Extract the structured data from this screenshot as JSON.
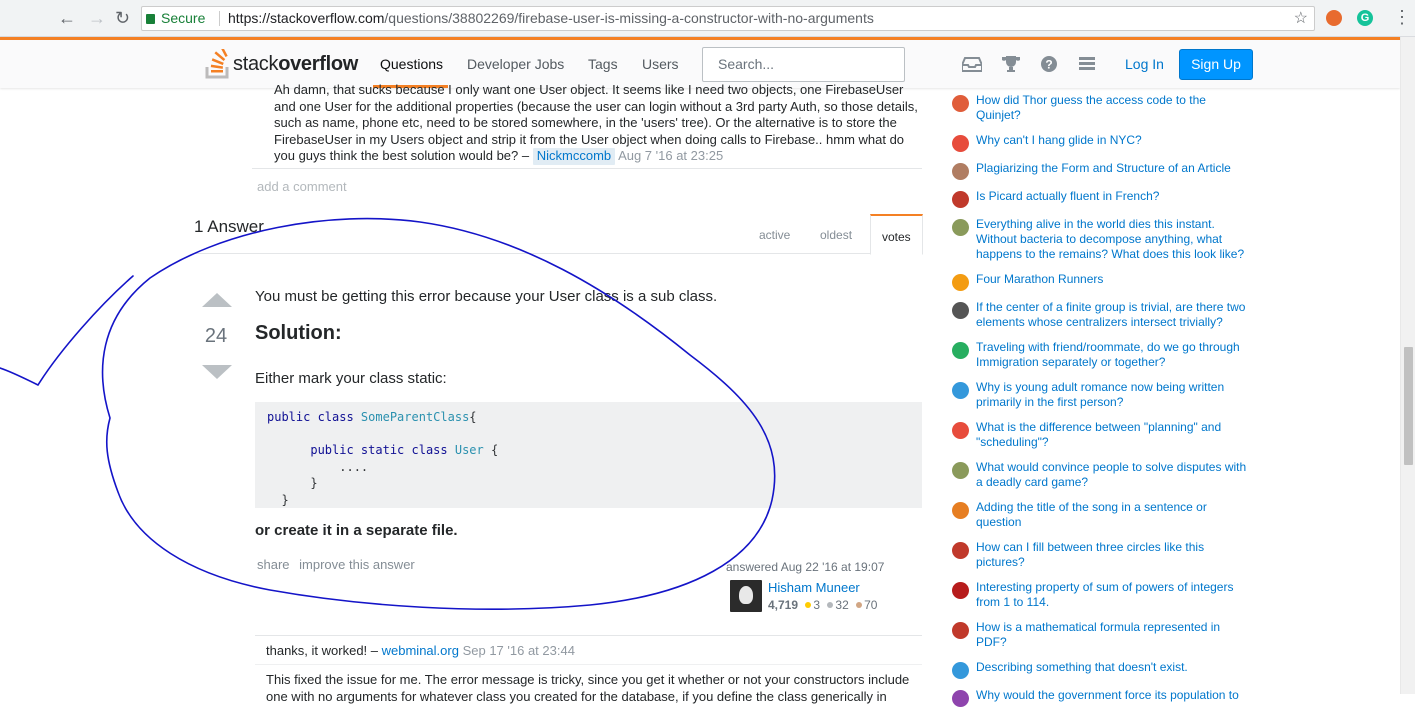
{
  "browser": {
    "secure_label": "Secure",
    "url_host": "https://stackoverflow.com",
    "url_path": "/questions/38802269/firebase-user-is-missing-a-constructor-with-no-arguments"
  },
  "header": {
    "logo_plain": "stack",
    "logo_bold": "overflow",
    "nav": [
      "Questions",
      "Developer Jobs",
      "Tags",
      "Users"
    ],
    "search_placeholder": "Search...",
    "login": "Log In",
    "signup": "Sign Up",
    "accent": "#f48024"
  },
  "comment": {
    "text": "Ah damn, that sucks because I only want one User object. It seems like I need two objects, one FirebaseUser and one User for the additional properties (because the user can login without a 3rd party Auth, so those details, such as name, phone etc, need to be stored somewhere, in the 'users' tree). Or the alternative is to store the FirebaseUser in my Users object and strip it from the User object when doing calls to Firebase.. hmm what do you guys think the best solution would be? –",
    "user": "Nickmccomb",
    "time": "Aug 7 '16 at 23:25",
    "add_comment": "add a comment"
  },
  "answers": {
    "heading": "1 Answer",
    "tabs": [
      "active",
      "oldest",
      "votes"
    ],
    "selected_tab": "votes"
  },
  "answer": {
    "votes": "24",
    "intro": "You must be getting this error because your User class is a sub class.",
    "heading": "Solution:",
    "mark_static": "Either mark your class static:",
    "code": {
      "l1_kw": "public class ",
      "l1_ty": "SomeParentClass",
      "l1_rest": "{",
      "l2_kw": "public static class ",
      "l2_ty": "User",
      "l2_rest": " {",
      "l3": "....",
      "l4": "}",
      "l5": "}"
    },
    "separate": "or create it in a separate file.",
    "share": "share",
    "improve": "improve this answer",
    "answered": "answered Aug 22 '16 at 19:07",
    "user_name": "Hisham Muneer",
    "reputation": "4,719",
    "gold": "3",
    "silver": "32",
    "bronze": "70"
  },
  "answer_comments": {
    "c1_text": "thanks, it worked! –",
    "c1_user": "webminal.org",
    "c1_time": "Sep 17 '16 at 23:44",
    "c2_text": "This fixed the issue for me. The error message is tricky, since you get it whether or not your constructors include one with no arguments for whatever class you created for the database, if you define the class generically in"
  },
  "hot_questions": [
    {
      "title": "How did Thor guess the access code to the Quinjet?",
      "color": "#e05d3a"
    },
    {
      "title": "Why can't I hang glide in NYC?",
      "color": "#e74c3c"
    },
    {
      "title": "Plagiarizing the Form and Structure of an Article",
      "color": "#b07d62"
    },
    {
      "title": "Is Picard actually fluent in French?",
      "color": "#c0392b"
    },
    {
      "title": "Everything alive in the world dies this instant. Without bacteria to decompose anything, what happens to the remains? What does this look like?",
      "color": "#8a9a5b"
    },
    {
      "title": "Four Marathon Runners",
      "color": "#f39c12"
    },
    {
      "title": "If the center of a finite group is trivial, are there two elements whose centralizers intersect trivially?",
      "color": "#555555"
    },
    {
      "title": "Traveling with friend/roommate, do we go through Immigration separately or together?",
      "color": "#27ae60"
    },
    {
      "title": "Why is young adult romance now being written primarily in the first person?",
      "color": "#3498db"
    },
    {
      "title": "What is the difference between \"planning\" and \"scheduling\"?",
      "color": "#e74c3c"
    },
    {
      "title": "What would convince people to solve disputes with a deadly card game?",
      "color": "#8a9a5b"
    },
    {
      "title": "Adding the title of the song in a sentence or question",
      "color": "#e67e22"
    },
    {
      "title": "How can I fill between three circles like this pictures?",
      "color": "#c0392b"
    },
    {
      "title": "Interesting property of sum of powers of integers from 1 to 114.",
      "color": "#b71c1c"
    },
    {
      "title": "How is a mathematical formula represented in PDF?",
      "color": "#c0392b"
    },
    {
      "title": "Describing something that doesn't exist.",
      "color": "#3498db"
    },
    {
      "title": "Why would the government force its population to",
      "color": "#8e44ad"
    }
  ]
}
